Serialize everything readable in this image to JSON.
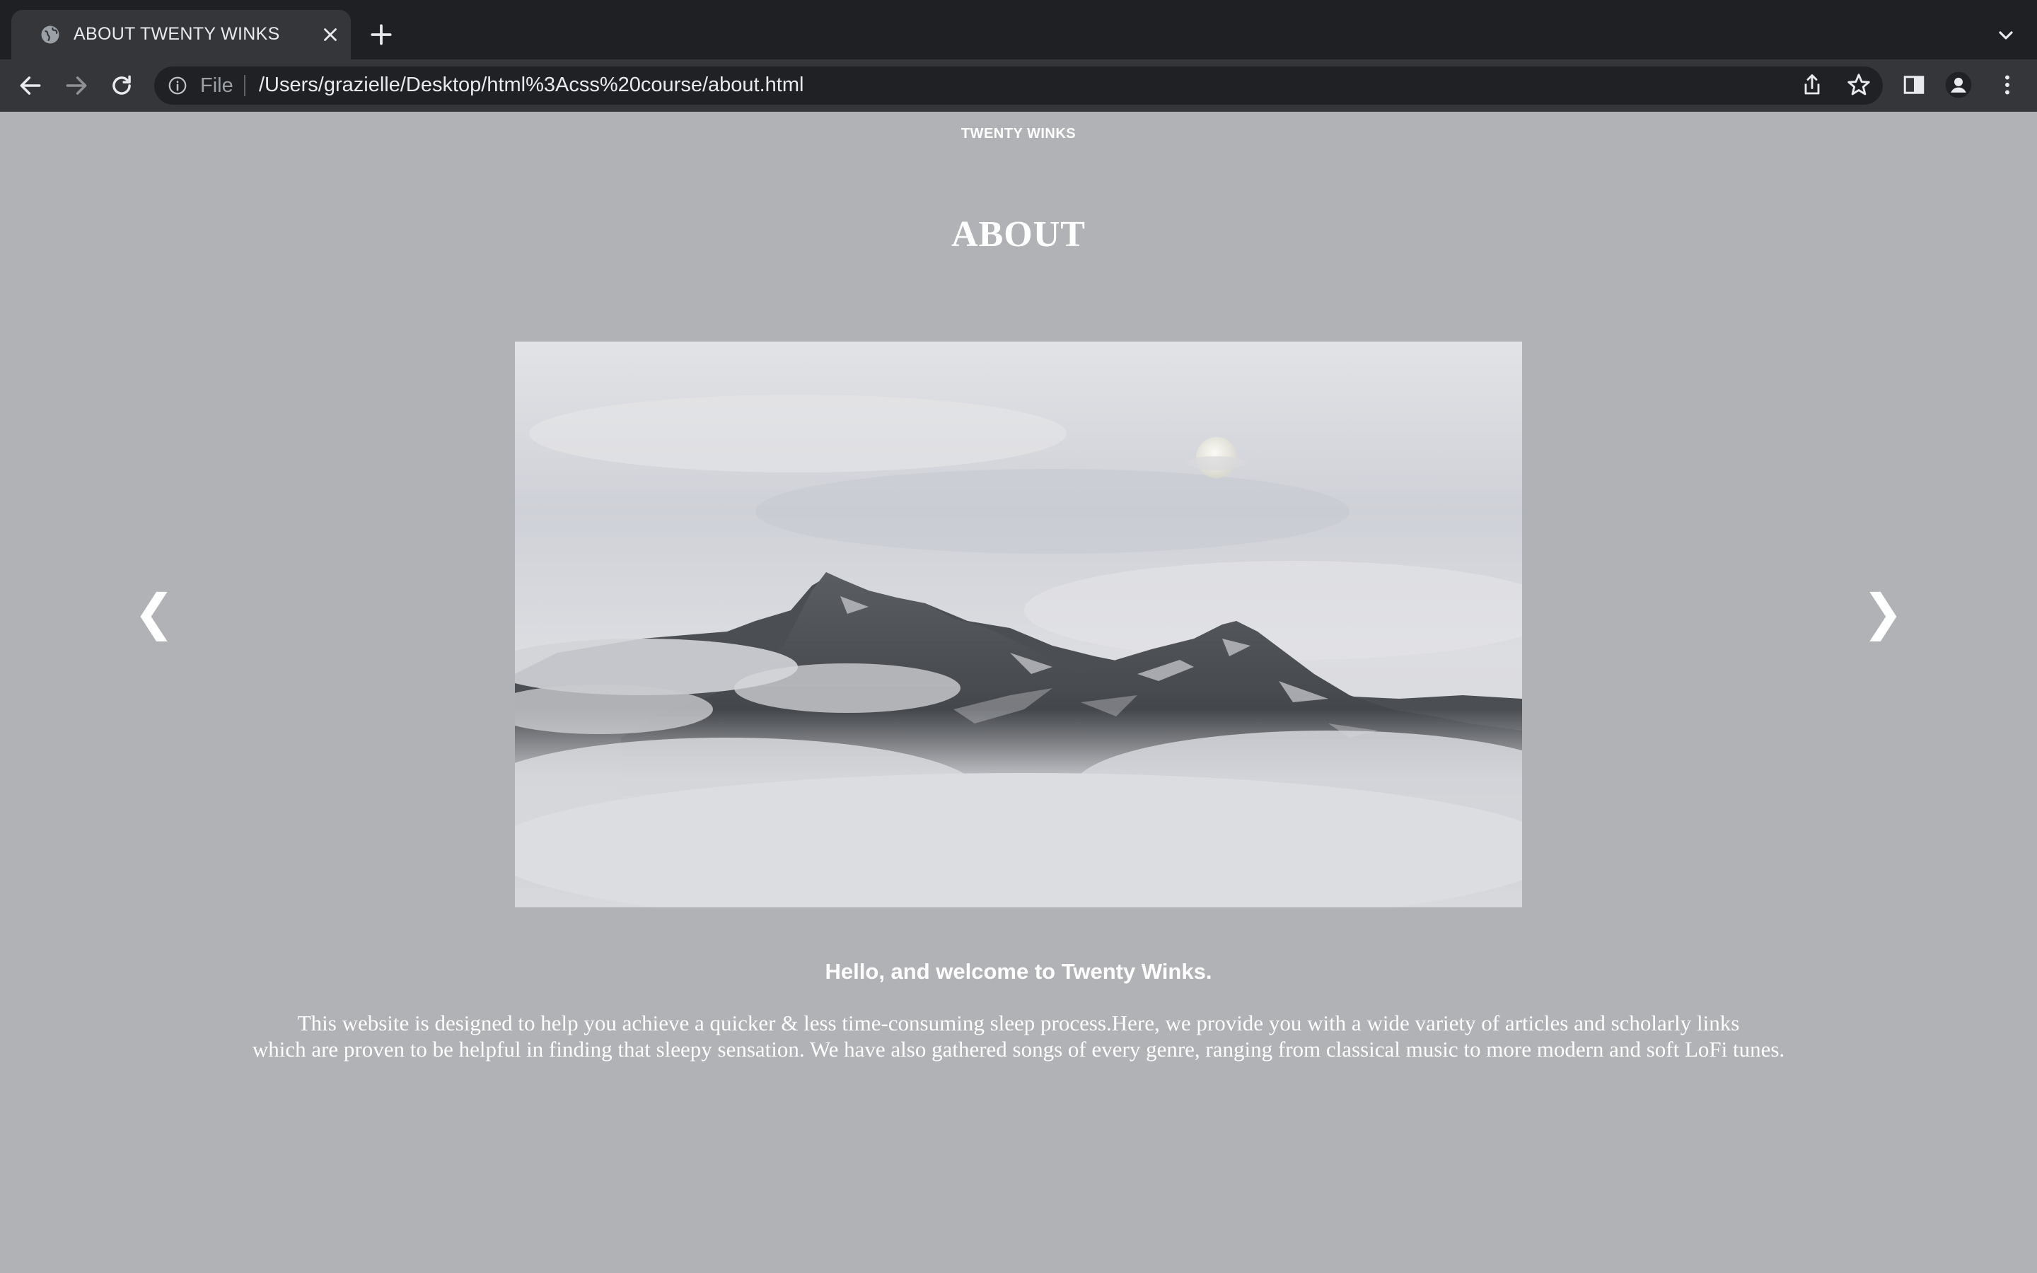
{
  "browser": {
    "tab_title": "ABOUT TWENTY WINKS",
    "omnibox_scheme": "File",
    "url": "/Users/grazielle/Desktop/html%3Acss%20course/about.html",
    "icons": [
      "globe-icon",
      "close-icon",
      "plus-icon",
      "chevron-down-icon",
      "back-arrow-icon",
      "forward-arrow-icon",
      "reload-icon",
      "info-icon",
      "share-icon",
      "star-icon",
      "side-panel-icon",
      "profile-icon",
      "more-vert-icon"
    ]
  },
  "page": {
    "brand": "TWENTY WINKS",
    "title": "ABOUT",
    "slideshow": {
      "prev_label": "❮",
      "next_label": "❯",
      "image": "misty mountain peaks above clouds with the moon"
    },
    "welcome": "Hello, and welcome to Twenty Winks.",
    "intro_line1": "This website is designed to help you achieve a quicker & less time-consuming sleep process.Here, we provide you with a wide variety of articles and scholarly links",
    "intro_line2": "which are proven to be helpful in finding that sleepy sensation. We have also gathered songs of every genre, ranging from classical music to more modern and soft LoFi tunes."
  },
  "colors": {
    "page_background": "#b1b2b5",
    "tabstrip": "#1f2024",
    "toolbar": "#35363a",
    "text": "#ffffff"
  }
}
